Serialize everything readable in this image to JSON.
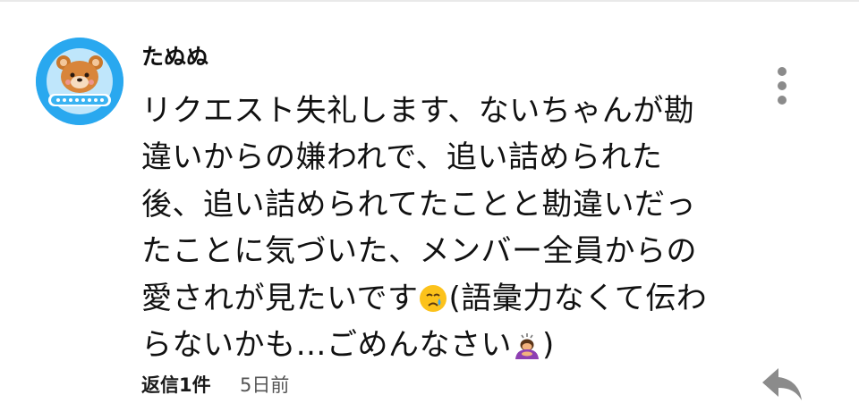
{
  "comment": {
    "author": "たぬぬ",
    "body_lines": [
      "リクエスト失礼します、ないちゃんが勘",
      "違いからの嫌われで、追い詰められた",
      "後、追い詰められてたことと勘違いだっ",
      "たことに気づいた、メンバー全員からの",
      "愛されが見たいです",
      "(語彙力なくて伝わ",
      "らないかも…ごめんなさい",
      ")"
    ],
    "reply_count": "返信1件",
    "timestamp": "5日前"
  },
  "icons": {
    "avatar": "bear-avatar-icon",
    "more": "more-vertical-icon",
    "reply": "reply-arrow-icon",
    "emoji_crying": "crying-face-emoji",
    "emoji_bowing": "bowing-person-emoji"
  },
  "colors": {
    "avatar_background": "#29a8ef",
    "author_text": "#0f0f0f",
    "body_text": "#111111",
    "meta_text": "#555555",
    "icon_gray": "#8b8b8b"
  }
}
